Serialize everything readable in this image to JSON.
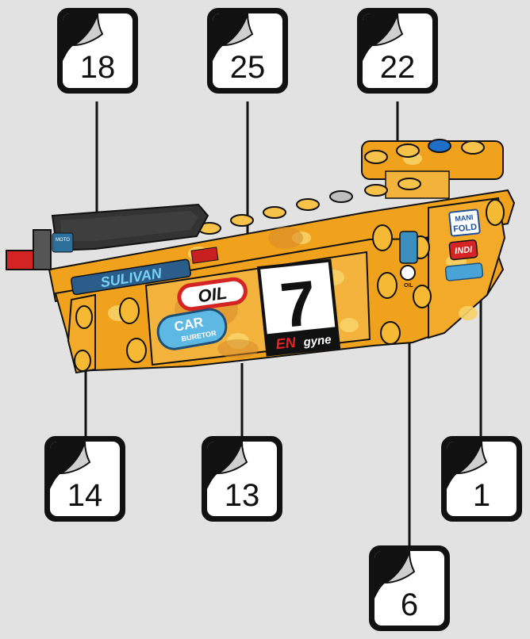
{
  "callouts": [
    {
      "id": "18",
      "label": "18"
    },
    {
      "id": "25",
      "label": "25"
    },
    {
      "id": "22",
      "label": "22"
    },
    {
      "id": "14",
      "label": "14"
    },
    {
      "id": "13",
      "label": "13"
    },
    {
      "id": "1",
      "label": "1"
    },
    {
      "id": "6",
      "label": "6"
    }
  ],
  "stickers": {
    "race_number": "7",
    "engine_brand_a": "EN",
    "engine_brand_b": "gyne",
    "oil": "OIL",
    "carb_top": "CAR",
    "carb_bottom": "BURETOR",
    "brand": "SULIVAN",
    "manifold_top": "MANI",
    "manifold_bottom": "FOLD",
    "indi": "INDI",
    "moto": "MOTO",
    "oil_small": "OIL"
  },
  "colors": {
    "background": "#e2e2e2",
    "panel": "#f2a51f",
    "panel_dark": "#d68a10",
    "camo": "#f7cc55",
    "outline": "#111111"
  }
}
